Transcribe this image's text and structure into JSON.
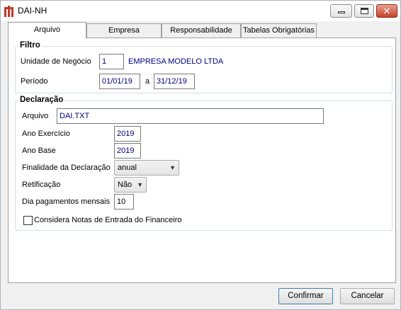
{
  "window": {
    "title": "DAI-NH"
  },
  "tabs": [
    {
      "label": "Arquivo"
    },
    {
      "label": "Empresa"
    },
    {
      "label": "Responsabilidade"
    },
    {
      "label": "Tabelas Obrigatórias"
    }
  ],
  "filtro": {
    "legend": "Filtro",
    "unidade_label": "Unidade de Negócio",
    "unidade_code": "1",
    "unidade_name": "EMPRESA MODELO LTDA",
    "periodo_label": "Período",
    "periodo_start": "01/01/19",
    "periodo_sep": "a",
    "periodo_end": "31/12/19"
  },
  "declaracao": {
    "legend": "Declaração",
    "arquivo_label": "Arquivo",
    "arquivo_value": "DAI.TXT",
    "ano_exercicio_label": "Ano Exercício",
    "ano_exercicio_value": "2019",
    "ano_base_label": "Ano Base",
    "ano_base_value": "2019",
    "finalidade_label": "Finalidade da Declaração",
    "finalidade_value": "anual",
    "retificacao_label": "Retificação",
    "retificacao_value": "Não",
    "dia_label": "Dia pagamentos mensais",
    "dia_value": "10",
    "considera_label": "Considera Notas de Entrada do Financeiro",
    "considera_checked": false
  },
  "buttons": {
    "confirm_label": "Confirmar",
    "cancel_label": "Cancelar"
  }
}
